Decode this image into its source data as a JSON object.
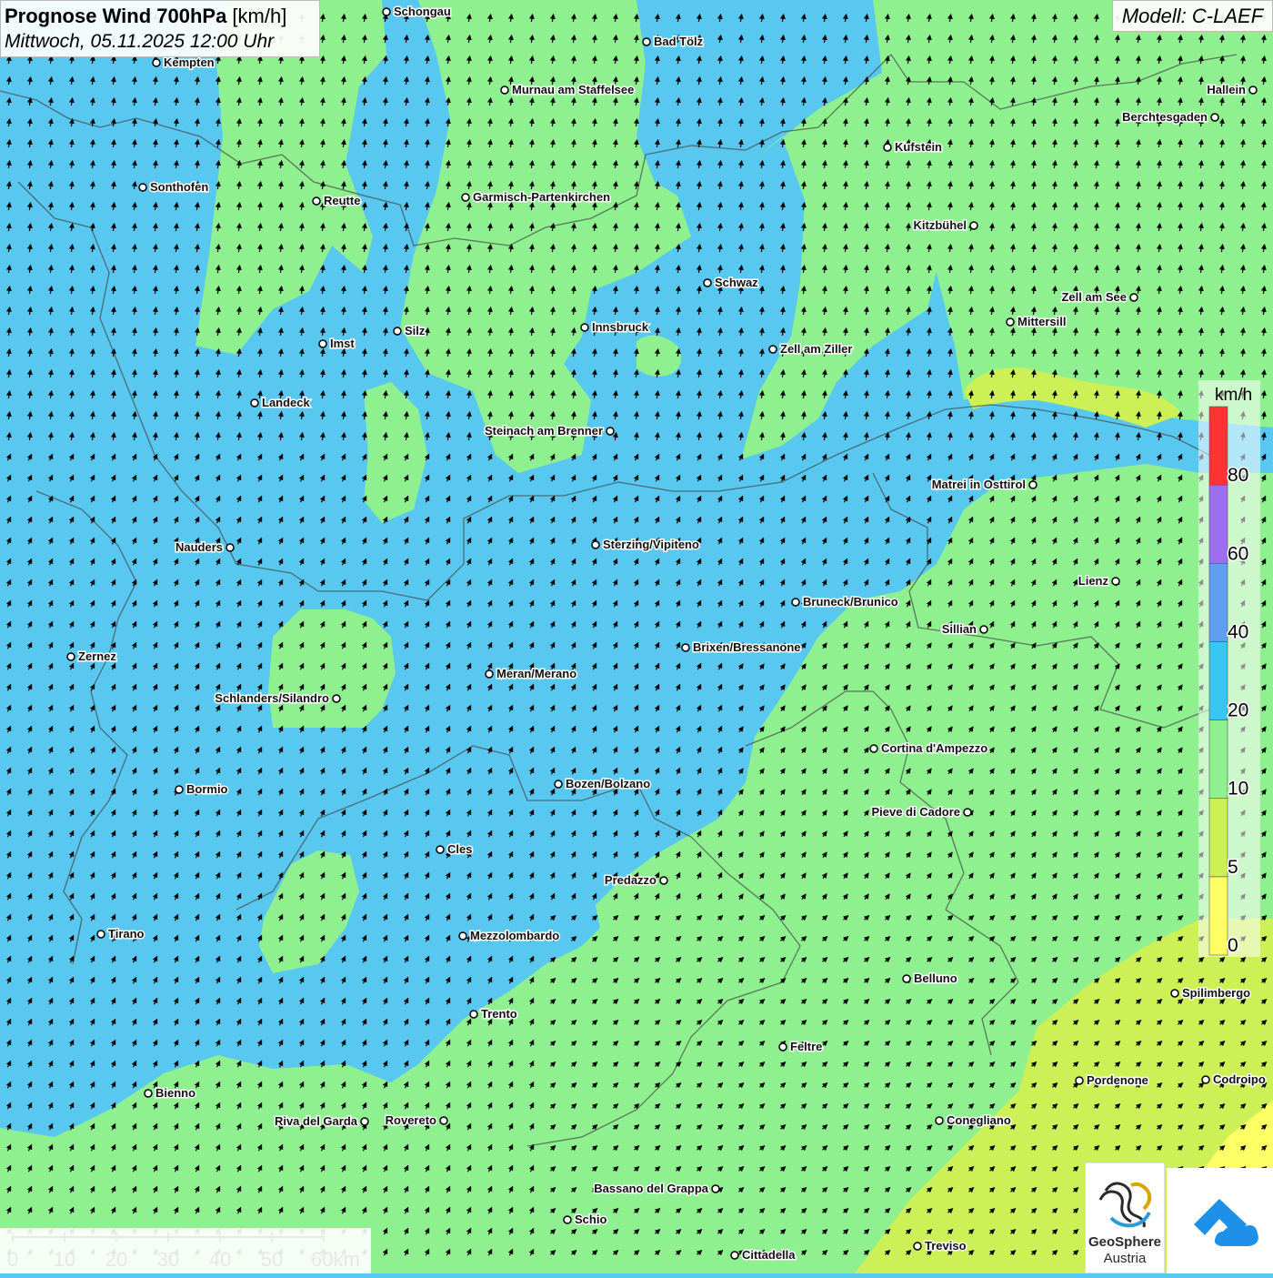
{
  "header": {
    "title_bold": "Prognose Wind 700hPa",
    "title_unit": " [km/h]",
    "date": "Mittwoch, 05.11.2025 12:00 Uhr"
  },
  "model": "Modell: C-LAEF",
  "legend": {
    "unit": "km/h",
    "colors": [
      "#ffff66",
      "#ccf055",
      "#8ef08e",
      "#37c7f2",
      "#5f9ff0",
      "#9d6ff0",
      "#ff3333"
    ],
    "labels": [
      "0",
      "5",
      "10",
      "20",
      "40",
      "60",
      "80"
    ]
  },
  "scalebar": {
    "labels": [
      "0",
      "10",
      "20",
      "30",
      "40",
      "50",
      "60km"
    ]
  },
  "logo": {
    "name_line1": "GeoSphere",
    "name_line2": "Austria"
  },
  "cities": [
    {
      "name": "Schongau"
    },
    {
      "name": "Bad Tölz"
    },
    {
      "name": "Kempten"
    },
    {
      "name": "Murnau am Staffelsee"
    },
    {
      "name": "Hallein"
    },
    {
      "name": "Berchtesgaden"
    },
    {
      "name": "Kufstein"
    },
    {
      "name": "Sonthofen"
    },
    {
      "name": "Reutte"
    },
    {
      "name": "Garmisch-Partenkirchen"
    },
    {
      "name": "Kitzbühel"
    },
    {
      "name": "Schwaz"
    },
    {
      "name": "Zell am See"
    },
    {
      "name": "Mittersill"
    },
    {
      "name": "Innsbruck"
    },
    {
      "name": "Silz"
    },
    {
      "name": "Imst"
    },
    {
      "name": "Zell am Ziller"
    },
    {
      "name": "Landeck"
    },
    {
      "name": "Steinach am Brenner"
    },
    {
      "name": "Matrei in Osttirol"
    },
    {
      "name": "Nauders"
    },
    {
      "name": "Sterzing/Vipiteno"
    },
    {
      "name": "Lienz"
    },
    {
      "name": "Bruneck/Brunico"
    },
    {
      "name": "Sillian"
    },
    {
      "name": "Brixen/Bressanone"
    },
    {
      "name": "Zernez"
    },
    {
      "name": "Meran/Merano"
    },
    {
      "name": "Schlanders/Silandro"
    },
    {
      "name": "Cortina d'Ampezzo"
    },
    {
      "name": "Bozen/Bolzano"
    },
    {
      "name": "Bormio"
    },
    {
      "name": "Pieve di Cadore"
    },
    {
      "name": "Cles"
    },
    {
      "name": "Predazzo"
    },
    {
      "name": "Tirano"
    },
    {
      "name": "Mezzolombardo"
    },
    {
      "name": "Belluno"
    },
    {
      "name": "Spilimbergo"
    },
    {
      "name": "Trento"
    },
    {
      "name": "Feltre"
    },
    {
      "name": "Pordenone"
    },
    {
      "name": "Codroipo"
    },
    {
      "name": "Bienno"
    },
    {
      "name": "Riva del Garda"
    },
    {
      "name": "Rovereto"
    },
    {
      "name": "Conegliano"
    },
    {
      "name": "Bassano del Grappa"
    },
    {
      "name": "Schio"
    },
    {
      "name": "Treviso"
    },
    {
      "name": "Cittadella"
    }
  ]
}
